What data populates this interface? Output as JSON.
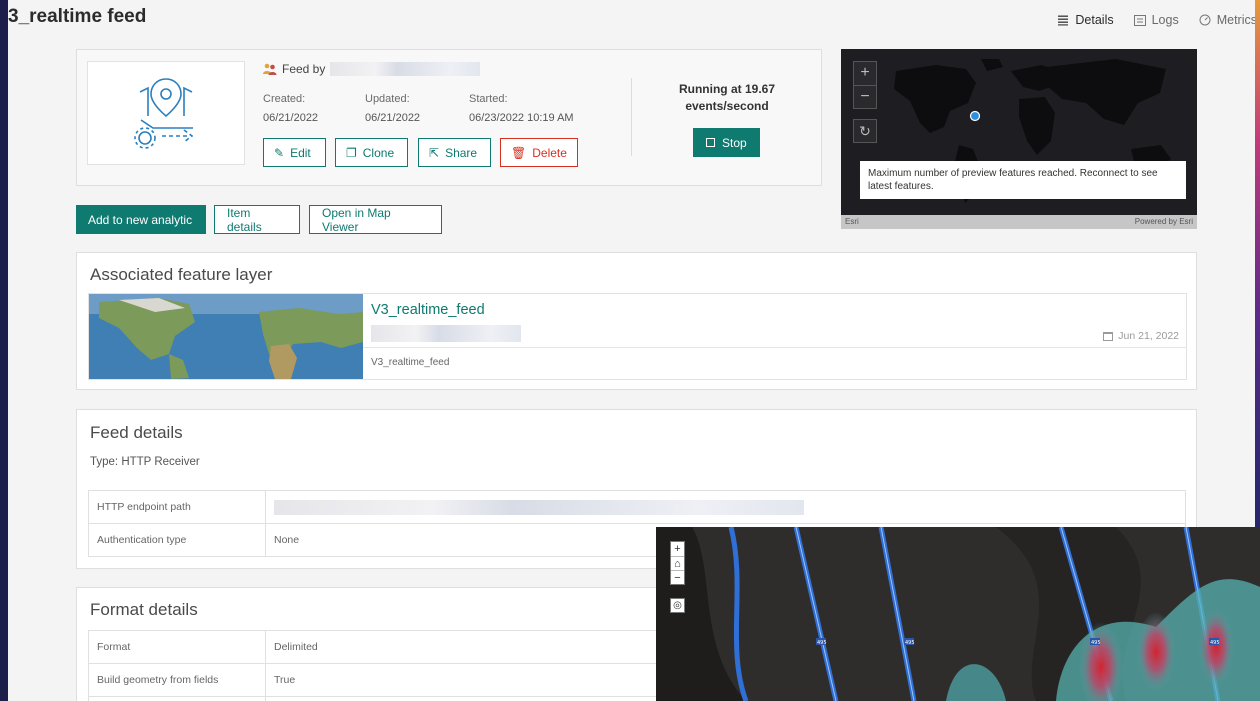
{
  "header": {
    "title": "3_realtime feed",
    "nav": [
      {
        "label": "Details",
        "icon": "details-icon",
        "active": true
      },
      {
        "label": "Logs",
        "icon": "logs-icon",
        "active": false
      },
      {
        "label": "Metrics",
        "icon": "metrics-icon",
        "active": false
      }
    ]
  },
  "summary": {
    "feed_by_label": "Feed by",
    "created_label": "Created:",
    "created_value": "06/21/2022",
    "updated_label": "Updated:",
    "updated_value": "06/21/2022",
    "started_label": "Started:",
    "started_value": "06/23/2022 10:19 AM",
    "buttons": {
      "edit": "Edit",
      "clone": "Clone",
      "share": "Share",
      "delete": "Delete"
    },
    "status_text": "Running at 19.67 events/second",
    "stop_label": "Stop"
  },
  "actions": {
    "add_to_analytic": "Add to new analytic",
    "item_details": "Item details",
    "open_map_viewer": "Open in Map Viewer"
  },
  "preview_map": {
    "zoom_in": "+",
    "zoom_out": "−",
    "message": "Maximum number of preview features reached. Reconnect to see latest features.",
    "attribution_left": "Esri",
    "attribution_right": "Powered by Esri"
  },
  "associated_layer": {
    "section_title": "Associated feature layer",
    "name": "V3_realtime_feed",
    "subtitle": "V3_realtime_feed",
    "date": "Jun 21, 2022"
  },
  "feed_details": {
    "section_title": "Feed details",
    "type_line": "Type: HTTP Receiver",
    "rows": [
      {
        "key": "HTTP endpoint path",
        "value": ""
      },
      {
        "key": "Authentication type",
        "value": "None"
      }
    ]
  },
  "format_details": {
    "section_title": "Format details",
    "rows": [
      {
        "key": "Format",
        "value": "Delimited"
      },
      {
        "key": "Build geometry from fields",
        "value": "True"
      }
    ]
  },
  "overlay_map": {
    "zoom_in": "+",
    "home": "⌂",
    "zoom_out": "−",
    "locate": "◎",
    "road_label": "495"
  },
  "colors": {
    "accent": "#0e7a70",
    "danger": "#d83020",
    "page_bg": "#f4f4f4"
  }
}
